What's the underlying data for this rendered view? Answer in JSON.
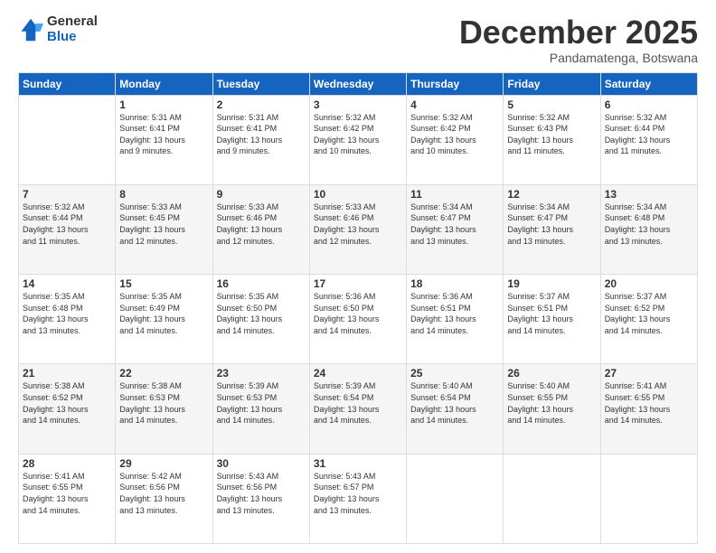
{
  "logo": {
    "general": "General",
    "blue": "Blue"
  },
  "header": {
    "month": "December 2025",
    "location": "Pandamatenga, Botswana"
  },
  "weekdays": [
    "Sunday",
    "Monday",
    "Tuesday",
    "Wednesday",
    "Thursday",
    "Friday",
    "Saturday"
  ],
  "weeks": [
    [
      {
        "day": "",
        "sunrise": "",
        "sunset": "",
        "daylight": ""
      },
      {
        "day": "1",
        "sunrise": "Sunrise: 5:31 AM",
        "sunset": "Sunset: 6:41 PM",
        "daylight": "Daylight: 13 hours and 9 minutes."
      },
      {
        "day": "2",
        "sunrise": "Sunrise: 5:31 AM",
        "sunset": "Sunset: 6:41 PM",
        "daylight": "Daylight: 13 hours and 9 minutes."
      },
      {
        "day": "3",
        "sunrise": "Sunrise: 5:32 AM",
        "sunset": "Sunset: 6:42 PM",
        "daylight": "Daylight: 13 hours and 10 minutes."
      },
      {
        "day": "4",
        "sunrise": "Sunrise: 5:32 AM",
        "sunset": "Sunset: 6:42 PM",
        "daylight": "Daylight: 13 hours and 10 minutes."
      },
      {
        "day": "5",
        "sunrise": "Sunrise: 5:32 AM",
        "sunset": "Sunset: 6:43 PM",
        "daylight": "Daylight: 13 hours and 11 minutes."
      },
      {
        "day": "6",
        "sunrise": "Sunrise: 5:32 AM",
        "sunset": "Sunset: 6:44 PM",
        "daylight": "Daylight: 13 hours and 11 minutes."
      }
    ],
    [
      {
        "day": "7",
        "sunrise": "Sunrise: 5:32 AM",
        "sunset": "Sunset: 6:44 PM",
        "daylight": "Daylight: 13 hours and 11 minutes."
      },
      {
        "day": "8",
        "sunrise": "Sunrise: 5:33 AM",
        "sunset": "Sunset: 6:45 PM",
        "daylight": "Daylight: 13 hours and 12 minutes."
      },
      {
        "day": "9",
        "sunrise": "Sunrise: 5:33 AM",
        "sunset": "Sunset: 6:46 PM",
        "daylight": "Daylight: 13 hours and 12 minutes."
      },
      {
        "day": "10",
        "sunrise": "Sunrise: 5:33 AM",
        "sunset": "Sunset: 6:46 PM",
        "daylight": "Daylight: 13 hours and 12 minutes."
      },
      {
        "day": "11",
        "sunrise": "Sunrise: 5:34 AM",
        "sunset": "Sunset: 6:47 PM",
        "daylight": "Daylight: 13 hours and 13 minutes."
      },
      {
        "day": "12",
        "sunrise": "Sunrise: 5:34 AM",
        "sunset": "Sunset: 6:47 PM",
        "daylight": "Daylight: 13 hours and 13 minutes."
      },
      {
        "day": "13",
        "sunrise": "Sunrise: 5:34 AM",
        "sunset": "Sunset: 6:48 PM",
        "daylight": "Daylight: 13 hours and 13 minutes."
      }
    ],
    [
      {
        "day": "14",
        "sunrise": "Sunrise: 5:35 AM",
        "sunset": "Sunset: 6:48 PM",
        "daylight": "Daylight: 13 hours and 13 minutes."
      },
      {
        "day": "15",
        "sunrise": "Sunrise: 5:35 AM",
        "sunset": "Sunset: 6:49 PM",
        "daylight": "Daylight: 13 hours and 14 minutes."
      },
      {
        "day": "16",
        "sunrise": "Sunrise: 5:35 AM",
        "sunset": "Sunset: 6:50 PM",
        "daylight": "Daylight: 13 hours and 14 minutes."
      },
      {
        "day": "17",
        "sunrise": "Sunrise: 5:36 AM",
        "sunset": "Sunset: 6:50 PM",
        "daylight": "Daylight: 13 hours and 14 minutes."
      },
      {
        "day": "18",
        "sunrise": "Sunrise: 5:36 AM",
        "sunset": "Sunset: 6:51 PM",
        "daylight": "Daylight: 13 hours and 14 minutes."
      },
      {
        "day": "19",
        "sunrise": "Sunrise: 5:37 AM",
        "sunset": "Sunset: 6:51 PM",
        "daylight": "Daylight: 13 hours and 14 minutes."
      },
      {
        "day": "20",
        "sunrise": "Sunrise: 5:37 AM",
        "sunset": "Sunset: 6:52 PM",
        "daylight": "Daylight: 13 hours and 14 minutes."
      }
    ],
    [
      {
        "day": "21",
        "sunrise": "Sunrise: 5:38 AM",
        "sunset": "Sunset: 6:52 PM",
        "daylight": "Daylight: 13 hours and 14 minutes."
      },
      {
        "day": "22",
        "sunrise": "Sunrise: 5:38 AM",
        "sunset": "Sunset: 6:53 PM",
        "daylight": "Daylight: 13 hours and 14 minutes."
      },
      {
        "day": "23",
        "sunrise": "Sunrise: 5:39 AM",
        "sunset": "Sunset: 6:53 PM",
        "daylight": "Daylight: 13 hours and 14 minutes."
      },
      {
        "day": "24",
        "sunrise": "Sunrise: 5:39 AM",
        "sunset": "Sunset: 6:54 PM",
        "daylight": "Daylight: 13 hours and 14 minutes."
      },
      {
        "day": "25",
        "sunrise": "Sunrise: 5:40 AM",
        "sunset": "Sunset: 6:54 PM",
        "daylight": "Daylight: 13 hours and 14 minutes."
      },
      {
        "day": "26",
        "sunrise": "Sunrise: 5:40 AM",
        "sunset": "Sunset: 6:55 PM",
        "daylight": "Daylight: 13 hours and 14 minutes."
      },
      {
        "day": "27",
        "sunrise": "Sunrise: 5:41 AM",
        "sunset": "Sunset: 6:55 PM",
        "daylight": "Daylight: 13 hours and 14 minutes."
      }
    ],
    [
      {
        "day": "28",
        "sunrise": "Sunrise: 5:41 AM",
        "sunset": "Sunset: 6:55 PM",
        "daylight": "Daylight: 13 hours and 14 minutes."
      },
      {
        "day": "29",
        "sunrise": "Sunrise: 5:42 AM",
        "sunset": "Sunset: 6:56 PM",
        "daylight": "Daylight: 13 hours and 13 minutes."
      },
      {
        "day": "30",
        "sunrise": "Sunrise: 5:43 AM",
        "sunset": "Sunset: 6:56 PM",
        "daylight": "Daylight: 13 hours and 13 minutes."
      },
      {
        "day": "31",
        "sunrise": "Sunrise: 5:43 AM",
        "sunset": "Sunset: 6:57 PM",
        "daylight": "Daylight: 13 hours and 13 minutes."
      },
      {
        "day": "",
        "sunrise": "",
        "sunset": "",
        "daylight": ""
      },
      {
        "day": "",
        "sunrise": "",
        "sunset": "",
        "daylight": ""
      },
      {
        "day": "",
        "sunrise": "",
        "sunset": "",
        "daylight": ""
      }
    ]
  ]
}
